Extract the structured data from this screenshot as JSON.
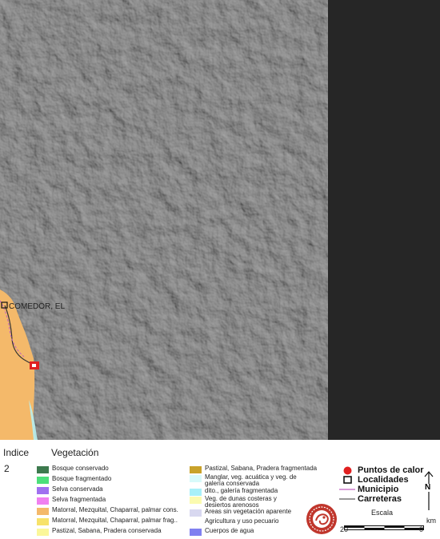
{
  "map": {
    "locality_label": "COMEDOR, EL",
    "colors": {
      "relief": "#6f6f6f",
      "relief_dark": "#4a4a4a",
      "no_data": "#262626",
      "shrubland": "#f4b96a",
      "municipio_line": "#c060c0",
      "road_line": "#333333",
      "hotspot": "#e02020",
      "coast_fringe": "#b8f0f0"
    }
  },
  "legend": {
    "index_header": "Indice",
    "vegetation_header": "Vegetación",
    "index_value": "2",
    "vegetation": [
      {
        "label": "Bosque conservado",
        "color": "#3d7a4e"
      },
      {
        "label": "Bosque fragmentado",
        "color": "#4ce07a"
      },
      {
        "label": "Selva conservada",
        "color": "#a070f0"
      },
      {
        "label": "Selva fragmentada",
        "color": "#f080f0"
      },
      {
        "label": "Matorral, Mezquital, Chaparral, palmar cons.",
        "color": "#f4b96a"
      },
      {
        "label": "Matorral, Mezquital, Chaparral, palmar frag..",
        "color": "#f7e26a"
      },
      {
        "label": "Pastizal, Sabana, Pradera conservada",
        "color": "#fbf79a"
      },
      {
        "label": "Pastizal, Sabana, Pradera fragmentada",
        "color": "#c9a22a"
      },
      {
        "label": "Manglar, veg. acuática y veg. de galería conservada",
        "color": "#d8fafa"
      },
      {
        "label": "dito., galería fragmentada",
        "color": "#a8f0f8"
      },
      {
        "label": "Veg. de dunas costeras y desiertos arenosos",
        "color": "#fbfbb0"
      },
      {
        "label": "Areas sin vegetación aparente",
        "color": "#d8d8f0"
      },
      {
        "label": "Agricultura y uso pecuario",
        "color": "#ffffff"
      },
      {
        "label": "Cuerpos de agua",
        "color": "#8080f0"
      }
    ],
    "symbols": {
      "hotspots": "Puntos de calor",
      "localities": "Localidades",
      "municipality": "Municipio",
      "roads": "Carreteras"
    },
    "north_letter": "N",
    "scale": {
      "title": "Escala",
      "left_value": "20",
      "right_value": "0",
      "unit": "km"
    }
  }
}
